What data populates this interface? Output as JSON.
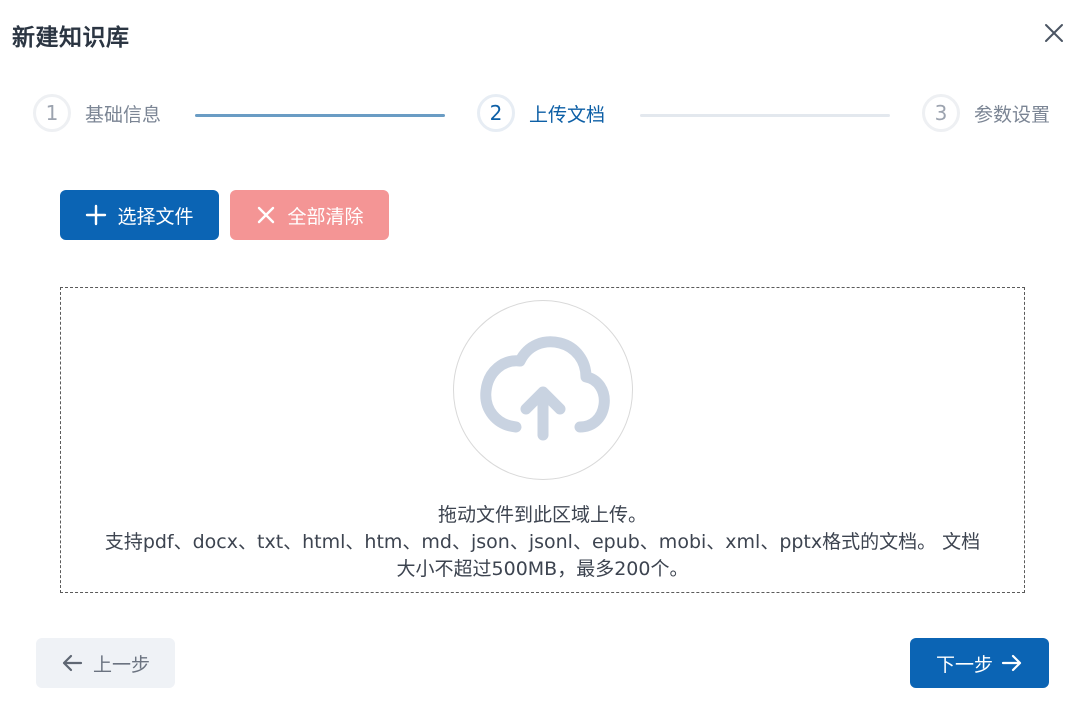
{
  "dialog": {
    "title": "新建知识库",
    "close_icon": "close-icon"
  },
  "steps": [
    {
      "number": "1",
      "label": "基础信息",
      "state": "done"
    },
    {
      "number": "2",
      "label": "上传文档",
      "state": "active"
    },
    {
      "number": "3",
      "label": "参数设置",
      "state": "pending"
    }
  ],
  "toolbar": {
    "select_files_label": "选择文件",
    "select_files_icon": "plus-icon",
    "clear_all_label": "全部清除",
    "clear_all_icon": "x-icon"
  },
  "dropzone": {
    "icon": "cloud-upload-icon",
    "line1": "拖动文件到此区域上传。",
    "line2": "支持pdf、docx、txt、html、htm、md、json、jsonl、epub、mobi、xml、pptx格式的文档。 文档",
    "line3": "大小不超过500MB，最多200个。"
  },
  "footer": {
    "prev_label": "上一步",
    "prev_icon": "arrow-left-icon",
    "next_label": "下一步",
    "next_icon": "arrow-right-icon"
  },
  "colors": {
    "primary": "#0b64b4",
    "danger_light": "#f49595",
    "step_active": "#0d5fa6",
    "line_done": "#6a9cc4",
    "line_pending": "#e3e8ee",
    "icon_muted": "#c9d3e1"
  }
}
